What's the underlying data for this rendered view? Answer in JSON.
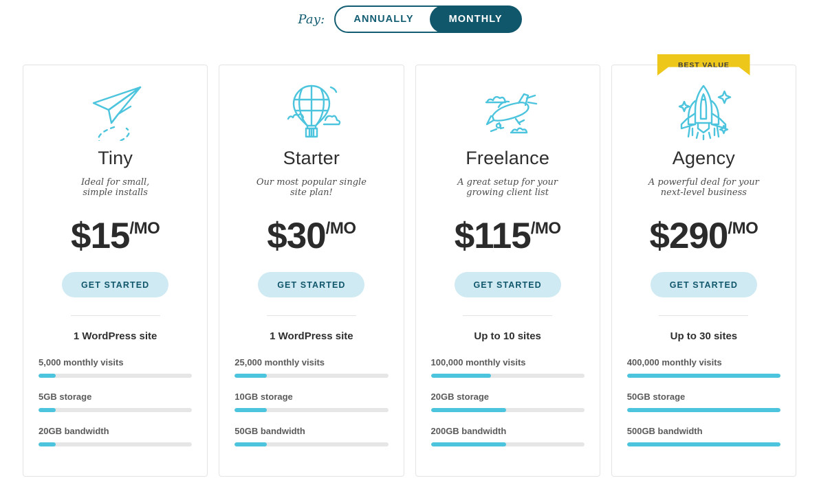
{
  "toggle": {
    "pay_label": "Pay:",
    "options": [
      {
        "label": "ANNUALLY",
        "active": false
      },
      {
        "label": "MONTHLY",
        "active": true
      }
    ]
  },
  "colors": {
    "accent_cyan": "#4cc4dd",
    "teal_dark": "#11576c",
    "cta_bg": "#cfeaf2",
    "ribbon_yellow": "#eec71b",
    "track_gray": "#e6e6e6"
  },
  "plans": [
    {
      "icon": "paper-plane-icon",
      "name": "Tiny",
      "tagline": "Ideal for small,\nsimple installs",
      "price_amount": "$15",
      "price_period": "/MO",
      "cta_label": "GET STARTED",
      "site_count": "1 WordPress site",
      "badge": null,
      "features": [
        {
          "label": "5,000 monthly visits",
          "percent": 11
        },
        {
          "label": "5GB storage",
          "percent": 11
        },
        {
          "label": "20GB bandwidth",
          "percent": 11
        }
      ]
    },
    {
      "icon": "hot-air-balloon-icon",
      "name": "Starter",
      "tagline": "Our most popular single\nsite plan!",
      "price_amount": "$30",
      "price_period": "/MO",
      "cta_label": "GET STARTED",
      "site_count": "1 WordPress site",
      "badge": null,
      "features": [
        {
          "label": "25,000 monthly visits",
          "percent": 21
        },
        {
          "label": "10GB storage",
          "percent": 21
        },
        {
          "label": "50GB bandwidth",
          "percent": 21
        }
      ]
    },
    {
      "icon": "airplane-icon",
      "name": "Freelance",
      "tagline": "A great setup for your\ngrowing client list",
      "price_amount": "$115",
      "price_period": "/MO",
      "cta_label": "GET STARTED",
      "site_count": "Up to 10 sites",
      "badge": null,
      "features": [
        {
          "label": "100,000 monthly visits",
          "percent": 39
        },
        {
          "label": "20GB storage",
          "percent": 49
        },
        {
          "label": "200GB bandwidth",
          "percent": 49
        }
      ]
    },
    {
      "icon": "rocket-icon",
      "name": "Agency",
      "tagline": "A powerful deal for your\nnext-level business",
      "price_amount": "$290",
      "price_period": "/MO",
      "cta_label": "GET STARTED",
      "site_count": "Up to 30 sites",
      "badge": "BEST VALUE",
      "features": [
        {
          "label": "400,000 monthly visits",
          "percent": 100
        },
        {
          "label": "50GB storage",
          "percent": 100
        },
        {
          "label": "500GB bandwidth",
          "percent": 100
        }
      ]
    }
  ]
}
